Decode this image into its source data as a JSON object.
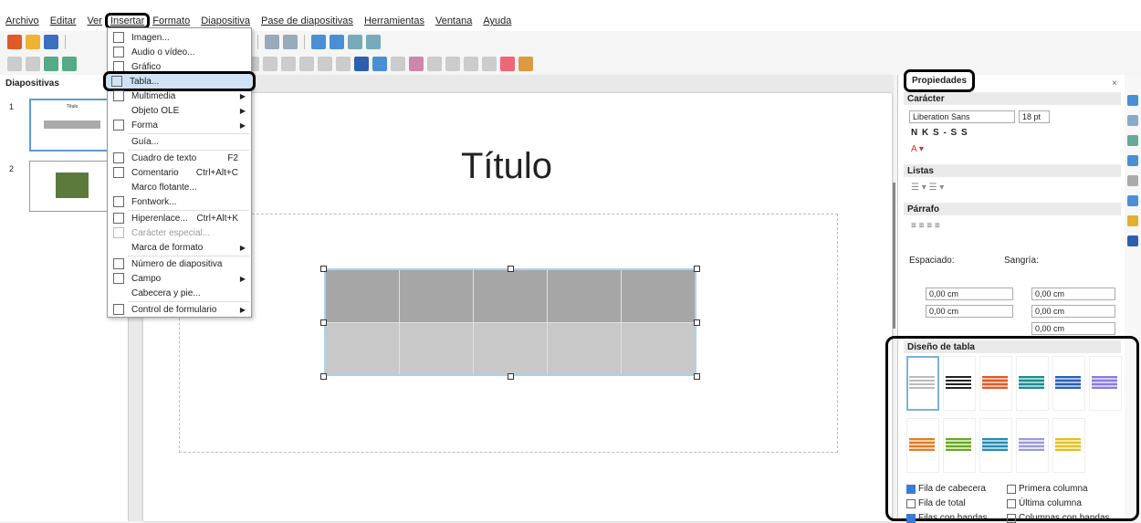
{
  "menubar": {
    "items": [
      "Archivo",
      "Editar",
      "Ver",
      "Insertar",
      "Formato",
      "Diapositiva",
      "Pase de diapositivas",
      "Herramientas",
      "Ventana",
      "Ayuda"
    ]
  },
  "slides_panel": {
    "title": "Diapositivas",
    "slide_numbers": [
      "1",
      "2"
    ],
    "thumb1_title": "Título"
  },
  "slide": {
    "title": "Título"
  },
  "insert_menu": {
    "items": [
      {
        "label": "Imagen...",
        "shortcut": "",
        "submenu": false,
        "disabled": false
      },
      {
        "label": "Audio o vídeo...",
        "shortcut": "",
        "submenu": false,
        "disabled": false
      },
      {
        "label": "Gráfico",
        "shortcut": "",
        "submenu": false,
        "disabled": false
      },
      {
        "label": "Tabla...",
        "shortcut": "",
        "submenu": false,
        "disabled": false
      },
      {
        "label": "Multimedia",
        "shortcut": "",
        "submenu": true,
        "disabled": false
      },
      {
        "label": "Objeto OLE",
        "shortcut": "",
        "submenu": true,
        "disabled": false
      },
      {
        "label": "Forma",
        "shortcut": "",
        "submenu": true,
        "disabled": false
      },
      {
        "label": "Guía...",
        "shortcut": "",
        "submenu": false,
        "disabled": false
      },
      {
        "label": "Cuadro de texto",
        "shortcut": "F2",
        "submenu": false,
        "disabled": false
      },
      {
        "label": "Comentario",
        "shortcut": "Ctrl+Alt+C",
        "submenu": false,
        "disabled": false
      },
      {
        "label": "Marco flotante...",
        "shortcut": "",
        "submenu": false,
        "disabled": false
      },
      {
        "label": "Fontwork...",
        "shortcut": "",
        "submenu": false,
        "disabled": false
      },
      {
        "label": "Hiperenlace...",
        "shortcut": "Ctrl+Alt+K",
        "submenu": false,
        "disabled": false
      },
      {
        "label": "Carácter especial...",
        "shortcut": "",
        "submenu": false,
        "disabled": true
      },
      {
        "label": "Marca de formato",
        "shortcut": "",
        "submenu": true,
        "disabled": false
      },
      {
        "label": "Número de diapositiva",
        "shortcut": "",
        "submenu": false,
        "disabled": false
      },
      {
        "label": "Campo",
        "shortcut": "",
        "submenu": true,
        "disabled": false
      },
      {
        "label": "Cabecera y pie...",
        "shortcut": "",
        "submenu": false,
        "disabled": false
      },
      {
        "label": "Control de formulario",
        "shortcut": "",
        "submenu": true,
        "disabled": false
      }
    ]
  },
  "sidebar": {
    "title": "Propiedades",
    "caracter": "Carácter",
    "font_name": "Liberation Sans",
    "font_size": "18 pt",
    "bold_row": "N K S - S S",
    "listas": "Listas",
    "parrafo": "Párrafo",
    "espaciado": "Espaciado:",
    "sangria": "Sangría:",
    "values": [
      "0,00 cm",
      "0,00 cm",
      "0,00 cm",
      "0,00 cm",
      "0,00 cm"
    ],
    "diseno": "Diseño de tabla",
    "checkboxes": [
      {
        "label": "Fila de cabecera",
        "checked": true
      },
      {
        "label": "Primera columna",
        "checked": false
      },
      {
        "label": "Fila de total",
        "checked": false
      },
      {
        "label": "Última columna",
        "checked": false
      },
      {
        "label": "Filas con bandas",
        "checked": true
      },
      {
        "label": "Columnas con bandas",
        "checked": false
      }
    ]
  }
}
